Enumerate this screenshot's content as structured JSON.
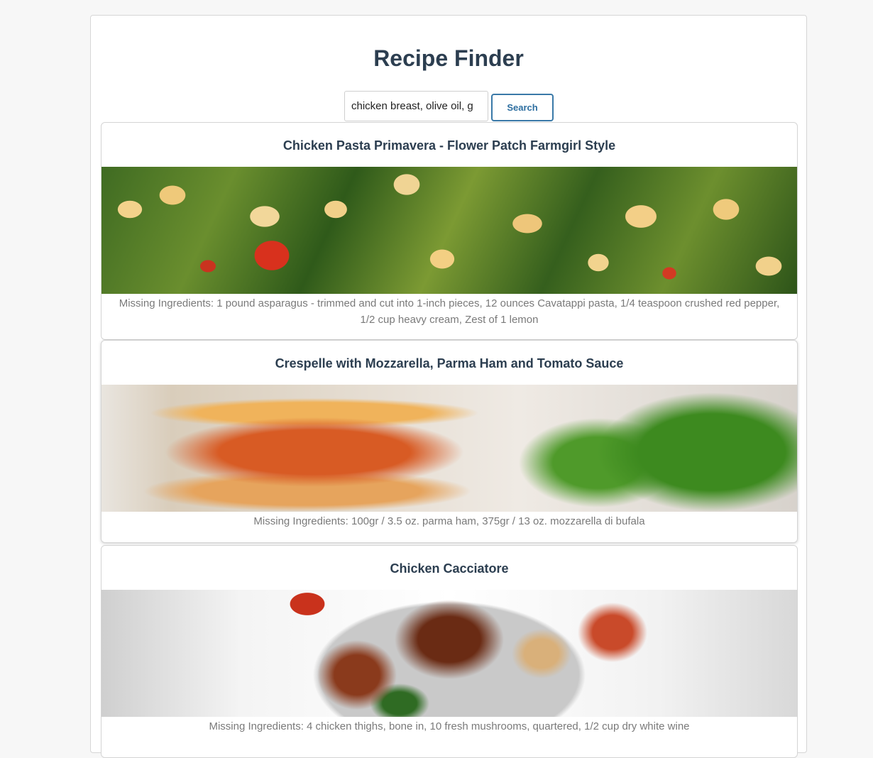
{
  "app": {
    "title": "Recipe Finder"
  },
  "search": {
    "value": "chicken breast, olive oil, g",
    "button_label": "Search"
  },
  "recipes": [
    {
      "title": "Chicken Pasta Primavera - Flower Patch Farmgirl Style",
      "missing": "Missing Ingredients: 1 pound asparagus - trimmed and cut into 1-inch pieces, 12 ounces Cavatappi pasta, 1/4 teaspoon crushed red pepper, 1/2 cup heavy cream, Zest of 1 lemon"
    },
    {
      "title": "Crespelle with Mozzarella, Parma Ham and Tomato Sauce",
      "missing": "Missing Ingredients: 100gr / 3.5 oz. parma ham, 375gr / 13 oz. mozzarella di bufala"
    },
    {
      "title": "Chicken Cacciatore",
      "missing": "Missing Ingredients: 4 chicken thighs, bone in, 10 fresh mushrooms, quartered, 1/2 cup dry white wine"
    }
  ]
}
